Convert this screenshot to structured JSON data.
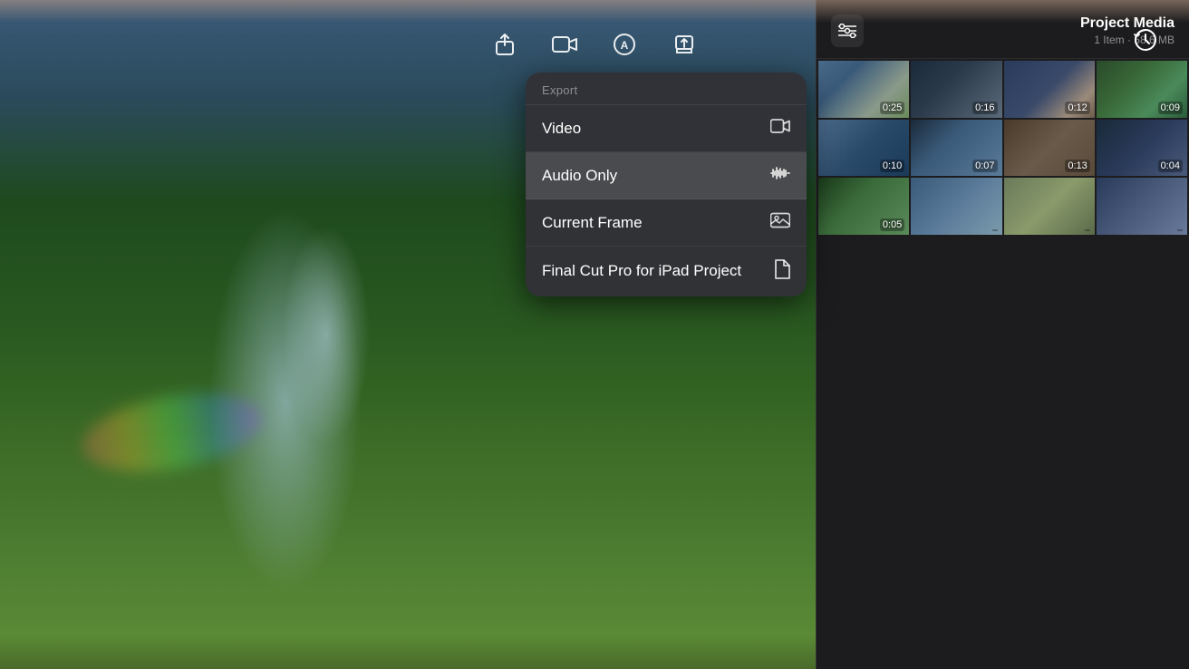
{
  "toolbar": {
    "icons": [
      {
        "name": "share-upload-icon",
        "symbol": "⬆",
        "label": "Share/Upload"
      },
      {
        "name": "camera-icon",
        "symbol": "⬛",
        "label": "Camera"
      },
      {
        "name": "autopilot-icon",
        "symbol": "Ⓐ",
        "label": "Auto"
      },
      {
        "name": "export-icon",
        "symbol": "⬆",
        "label": "Export"
      }
    ],
    "right_icon": {
      "name": "history-icon",
      "symbol": "↺",
      "label": "History"
    }
  },
  "export_menu": {
    "header": "Export",
    "items": [
      {
        "id": "video",
        "label": "Video",
        "icon": "video-camera-icon"
      },
      {
        "id": "audio-only",
        "label": "Audio Only",
        "icon": "waveform-icon",
        "highlighted": true
      },
      {
        "id": "current-frame",
        "label": "Current Frame",
        "icon": "image-icon"
      },
      {
        "id": "fcp-project",
        "label": "Final Cut Pro for iPad Project",
        "icon": "document-icon"
      }
    ]
  },
  "right_panel": {
    "title": "Project Media",
    "subtitle": "1 Item · 58.6 MB",
    "filter_icon": "≡",
    "history_icon": "↺",
    "media_items": [
      {
        "id": 1,
        "duration": "0:25",
        "thumb_class": "thumb-1"
      },
      {
        "id": 2,
        "duration": "0:16",
        "thumb_class": "thumb-2"
      },
      {
        "id": 3,
        "duration": "0:12",
        "thumb_class": "thumb-3"
      },
      {
        "id": 4,
        "duration": "0:09",
        "thumb_class": "thumb-4"
      },
      {
        "id": 5,
        "duration": "0:10",
        "thumb_class": "thumb-5"
      },
      {
        "id": 6,
        "duration": "0:07",
        "thumb_class": "thumb-6"
      },
      {
        "id": 7,
        "duration": "0:13",
        "thumb_class": "thumb-7"
      },
      {
        "id": 8,
        "duration": "0:04",
        "thumb_class": "thumb-8"
      },
      {
        "id": 9,
        "duration": "0:05",
        "thumb_class": "thumb-9"
      },
      {
        "id": 10,
        "duration": "",
        "thumb_class": "thumb-10"
      },
      {
        "id": 11,
        "duration": "",
        "thumb_class": "thumb-11"
      },
      {
        "id": 12,
        "duration": "",
        "thumb_class": "thumb-12"
      }
    ]
  }
}
